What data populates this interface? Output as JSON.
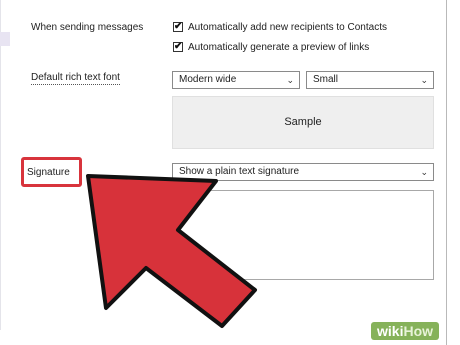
{
  "settings": {
    "sending_label": "When sending messages",
    "checkboxes": [
      {
        "label": "Automatically add new recipients to Contacts",
        "checked": true
      },
      {
        "label": "Automatically generate a preview of links",
        "checked": true
      }
    ],
    "font_label": "Default rich text font",
    "font_family_value": "Modern wide",
    "font_size_value": "Small",
    "sample_text": "Sample",
    "signature_label": "Signature",
    "signature_select_value": "Show a plain text signature"
  },
  "icons": {
    "check": "✔",
    "chevron": "⌄"
  },
  "watermark": {
    "wiki": "wiki",
    "how": "How"
  },
  "colors": {
    "highlight": "#d8343c",
    "arrow": "#d7323a"
  }
}
